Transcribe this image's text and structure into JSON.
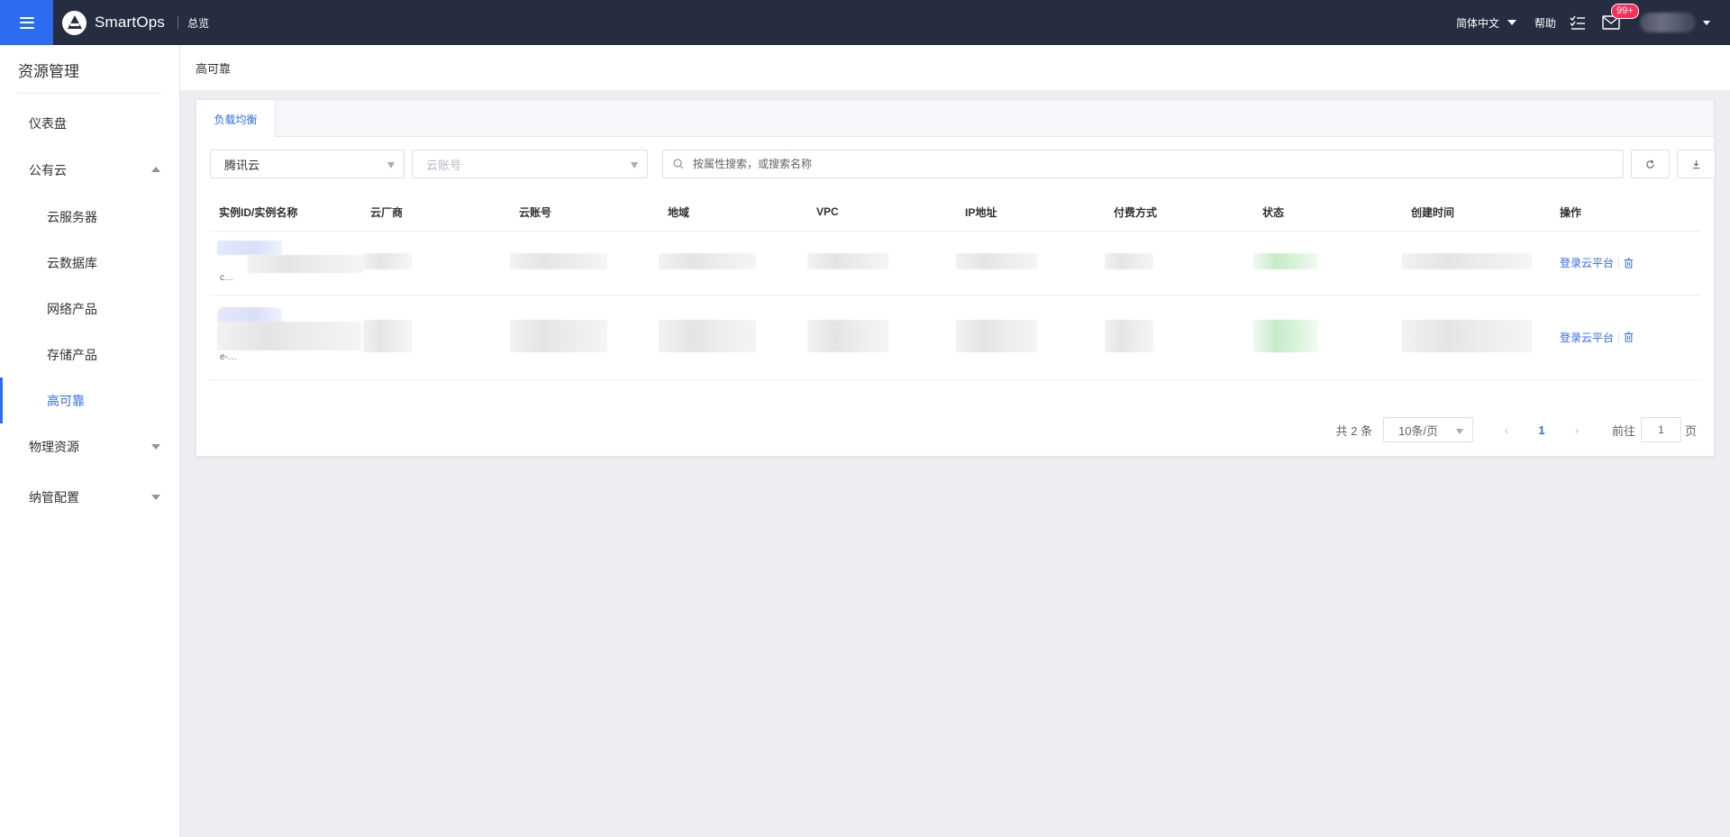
{
  "app": {
    "name": "SmartOps",
    "overview": "总览"
  },
  "header": {
    "language": "简体中文",
    "help": "帮助",
    "notifications_badge": "99+",
    "colors": {
      "bar": "#262d40",
      "accent": "#2d6cf0",
      "badge": "#f5315c"
    }
  },
  "sidebar": {
    "title": "资源管理",
    "items": [
      {
        "label": "仪表盘"
      },
      {
        "label": "公有云",
        "expanded": true
      },
      {
        "label": "云服务器"
      },
      {
        "label": "云数据库"
      },
      {
        "label": "网络产品"
      },
      {
        "label": "存储产品"
      },
      {
        "label": "高可靠",
        "active": true
      },
      {
        "label": "物理资源",
        "expanded": false
      },
      {
        "label": "纳管配置",
        "expanded": false
      }
    ]
  },
  "breadcrumb": "高可靠",
  "tabs": [
    {
      "label": "负载均衡",
      "active": true
    }
  ],
  "filters": {
    "provider": "腾讯云",
    "account_placeholder": "云账号",
    "search_placeholder": "按属性搜索，或搜索名称"
  },
  "table": {
    "columns": [
      "实例ID/实例名称",
      "云厂商",
      "云账号",
      "地域",
      "VPC",
      "IP地址",
      "付费方式",
      "状态",
      "创建时间",
      "操作"
    ],
    "rows": [
      {
        "name_fragment": "c…",
        "action": "登录云平台"
      },
      {
        "name_fragment": "e-…",
        "action": "登录云平台"
      }
    ]
  },
  "pagination": {
    "total_text": "共 2 条",
    "page_size": "10条/页",
    "current_page": "1",
    "goto_label": "前往",
    "goto_value": "1",
    "page_suffix": "页"
  }
}
